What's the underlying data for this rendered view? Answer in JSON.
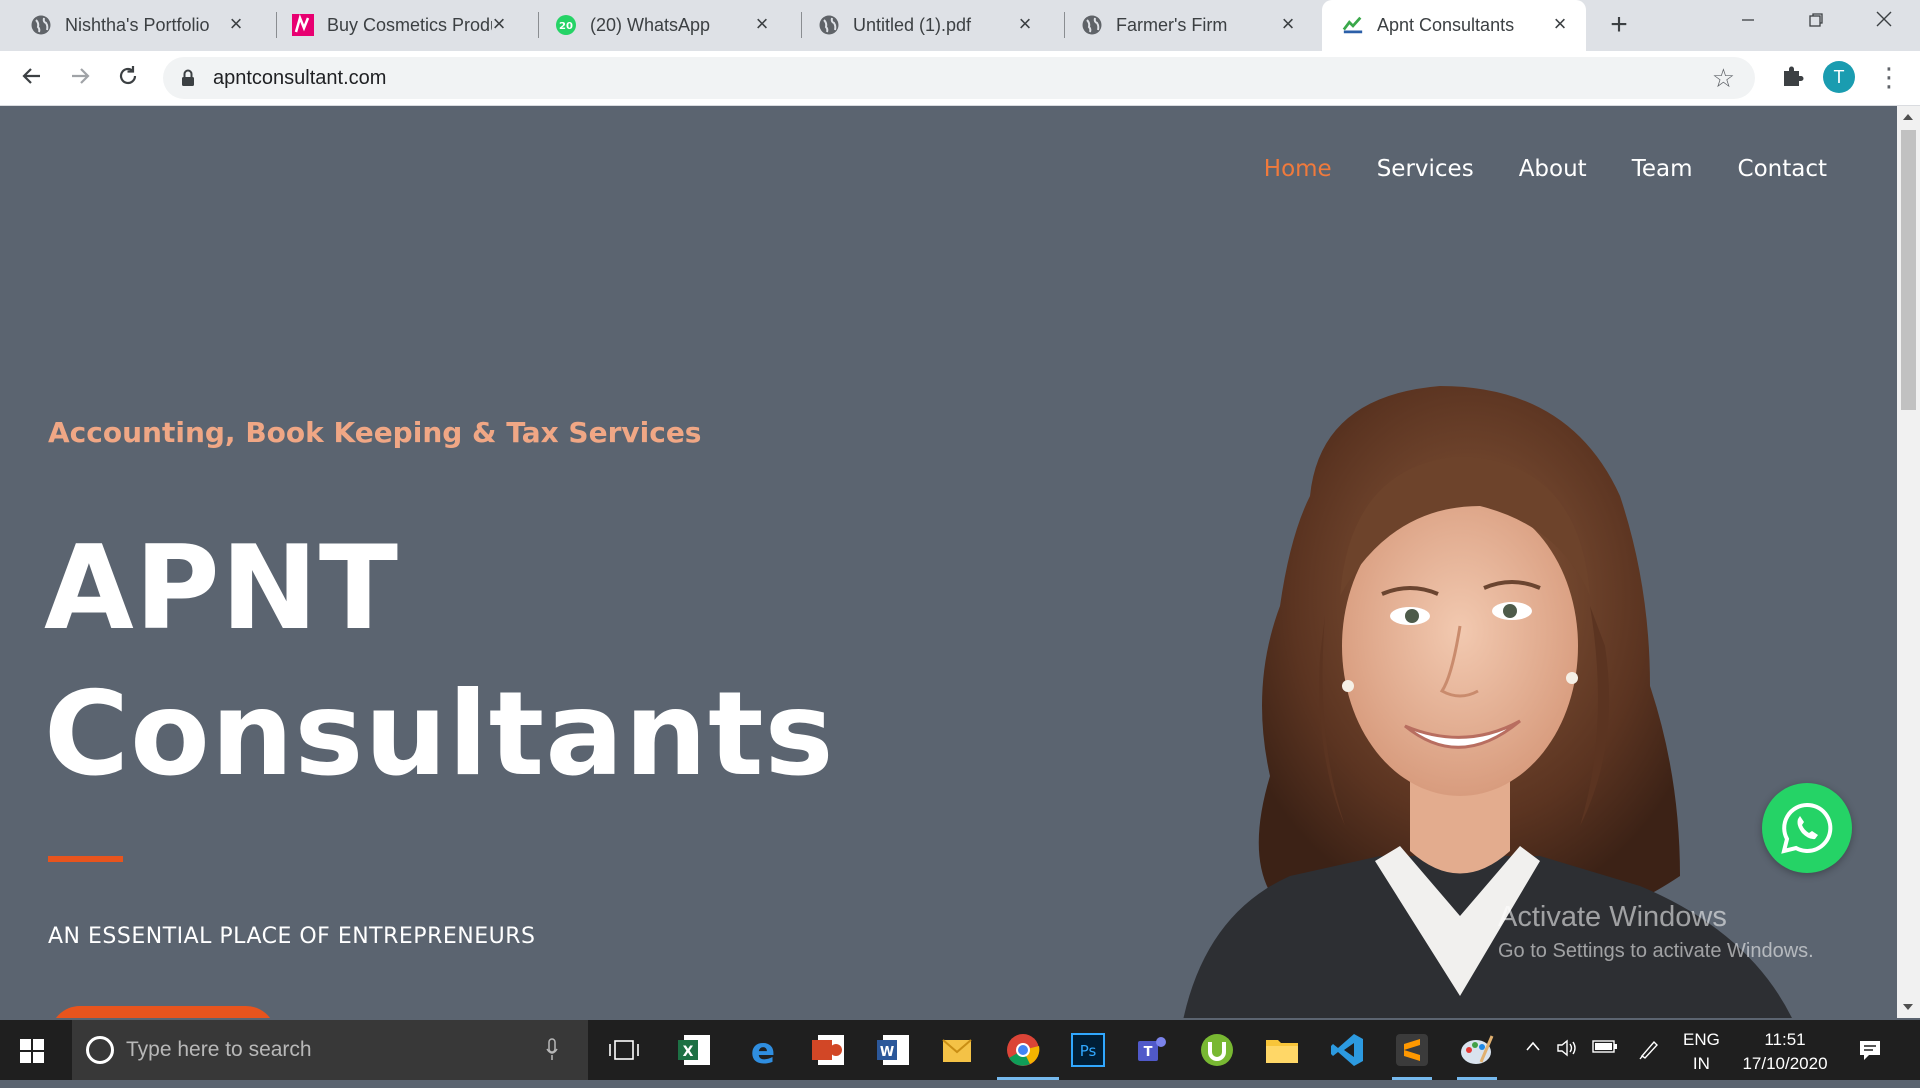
{
  "browser": {
    "tabs": [
      {
        "title": "Nishtha's Portfolio",
        "icon": "globe-icon"
      },
      {
        "title": "Buy Cosmetics Produ",
        "icon": "nykaa-icon"
      },
      {
        "title": "(20) WhatsApp",
        "icon": "whatsapp-icon",
        "badge": "20"
      },
      {
        "title": "Untitled (1).pdf",
        "icon": "globe-icon"
      },
      {
        "title": "Farmer's Firm",
        "icon": "globe-icon"
      },
      {
        "title": "Apnt Consultants",
        "icon": "site-logo-icon",
        "active": true
      }
    ],
    "url": "apntconsultant.com",
    "profile_initial": "T"
  },
  "site": {
    "nav": [
      "Home",
      "Services",
      "About",
      "Team",
      "Contact"
    ],
    "nav_active": "Home",
    "subtitle": "Accounting, Book Keeping & Tax Services",
    "title_line1": "APNT",
    "title_line2": "Consultants",
    "tagline": "AN ESSENTIAL PLACE OF ENTREPRENEURS",
    "accent_color": "#e8541d",
    "background_color": "#5b6470"
  },
  "watermark": {
    "line1": "Activate Windows",
    "line2": "Go to Settings to activate Windows."
  },
  "taskbar": {
    "search_placeholder": "Type here to search",
    "apps": [
      "task-view",
      "excel",
      "edge",
      "powerpoint",
      "word",
      "outlook",
      "chrome",
      "photoshop",
      "teams",
      "utorrent",
      "file-explorer",
      "vscode",
      "sublime-text",
      "paint"
    ],
    "language": "ENG",
    "region": "IN",
    "time": "11:51",
    "date": "17/10/2020"
  }
}
